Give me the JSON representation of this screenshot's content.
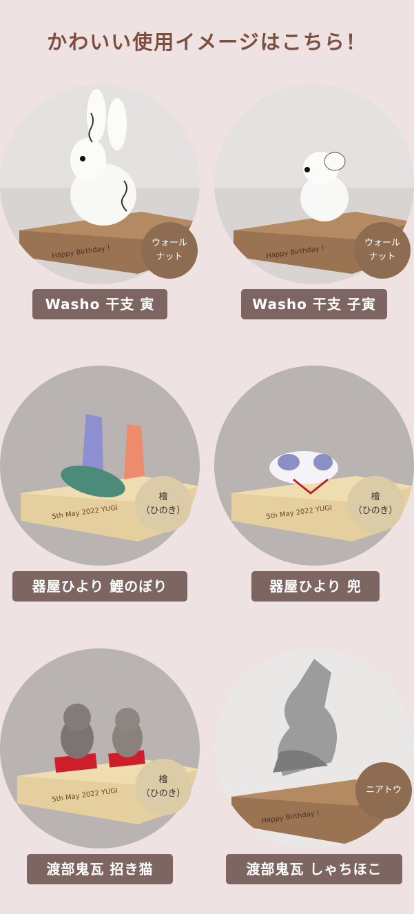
{
  "heading": "かわいい使用イメージはこちら！",
  "items": [
    {
      "caption": "Washo 干支 寅",
      "wood": "ウォール\nナット",
      "engraving": "Happy Birthday !"
    },
    {
      "caption": "Washo 干支 子寅",
      "wood": "ウォール\nナット",
      "engraving": "Happy Birthday !"
    },
    {
      "caption": "器屋ひより 鯉のぼり",
      "wood": "檜\n（ひのき）",
      "engraving": "5th May 2022 YUGI"
    },
    {
      "caption": "器屋ひより 兜",
      "wood": "檜\n（ひのき）",
      "engraving": "5th May 2022 YUGI"
    },
    {
      "caption": "渡部鬼瓦 招き猫",
      "wood": "檜\n（ひのき）",
      "engraving": "5th May 2022 YUGI"
    },
    {
      "caption": "渡部鬼瓦 しゃちほこ",
      "wood": "ニアトウ",
      "engraving": "Happy Birthday !"
    }
  ],
  "colors": {
    "background": "#efe2e3",
    "caption_bg": "#7d6562",
    "walnut_badge": "#8e6c52",
    "hinoki_badge": "#dccba7",
    "heading": "#7c4e3e"
  }
}
